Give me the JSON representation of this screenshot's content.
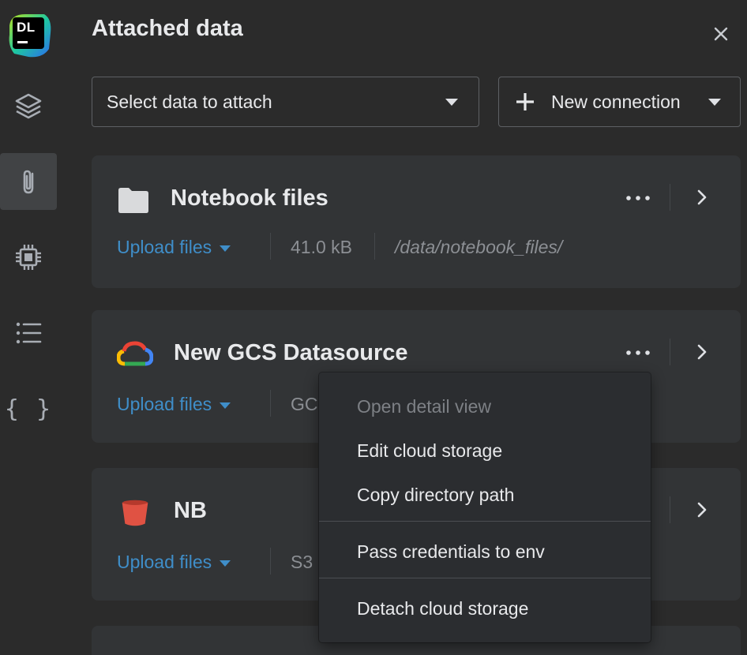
{
  "app": {
    "logo_text": "DL"
  },
  "sidebar": {
    "items": [
      {
        "name": "layers",
        "icon": "layers-icon"
      },
      {
        "name": "attached-data",
        "icon": "paperclip-icon",
        "active": true
      },
      {
        "name": "compute",
        "icon": "chip-icon"
      },
      {
        "name": "list",
        "icon": "list-icon"
      },
      {
        "name": "variables",
        "icon": "braces-icon",
        "glyph": "{ }"
      }
    ]
  },
  "header": {
    "title": "Attached data",
    "select_placeholder": "Select data to attach",
    "new_connection_label": "New connection"
  },
  "cards": [
    {
      "name": "Notebook files",
      "icon": "folder-icon",
      "upload_label": "Upload files",
      "size": "41.0 kB",
      "path": "/data/notebook_files/"
    },
    {
      "name": "New GCS Datasource",
      "icon": "google-cloud-icon",
      "upload_label": "Upload files",
      "type_partial": "GC"
    },
    {
      "name": "NB",
      "icon": "bucket-icon",
      "upload_label": "Upload files",
      "type_partial": "S3"
    }
  ],
  "context_menu": {
    "items": [
      {
        "label": "Open detail view",
        "disabled": true
      },
      {
        "label": "Edit cloud storage",
        "disabled": false
      },
      {
        "label": "Copy directory path",
        "disabled": false
      },
      {
        "label": "Pass credentials to env",
        "disabled": false
      },
      {
        "label": "Detach cloud storage",
        "disabled": false
      }
    ]
  },
  "colors": {
    "background": "#2b2b2b",
    "card": "#323436",
    "link": "#3f8ec9",
    "bucket": "#e05243"
  }
}
